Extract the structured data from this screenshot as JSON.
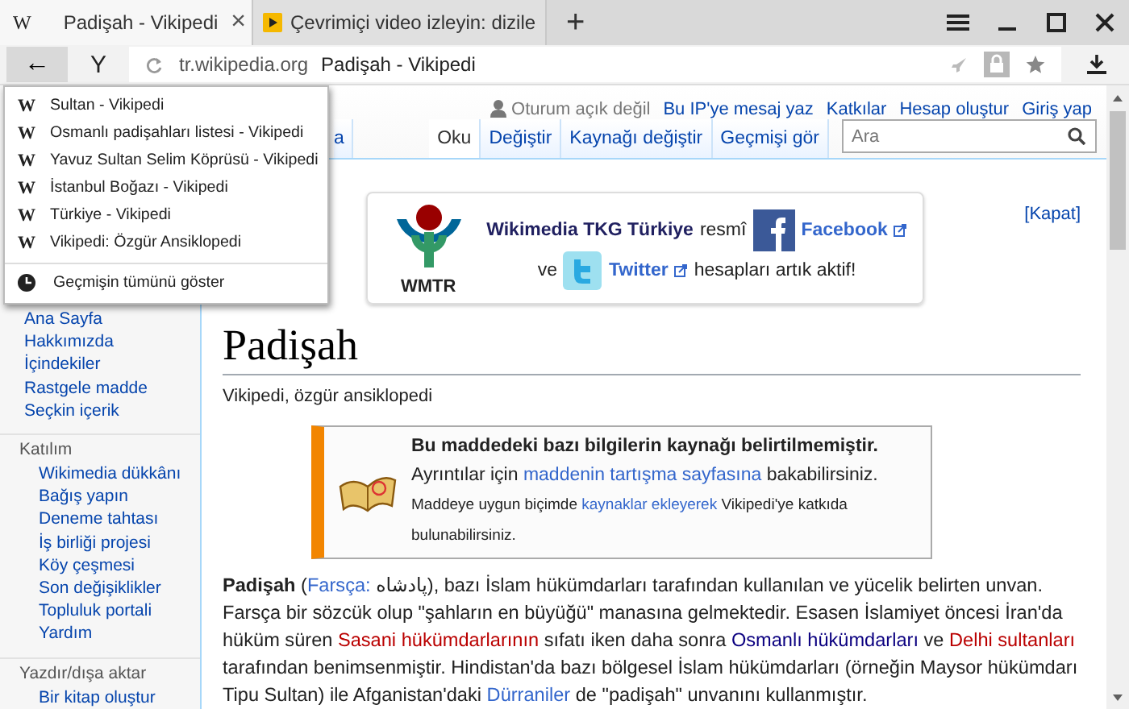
{
  "browser": {
    "tabs": [
      {
        "kind": "wiki",
        "favicon": "W",
        "title": "Padişah - Vikipedi",
        "close": "×",
        "selected": true
      },
      {
        "kind": "video",
        "title": "Çevrimiçi video izleyin: dizile",
        "selected": false
      }
    ],
    "new_tab": "+",
    "toolbar": {
      "back": "←",
      "logo": "Y",
      "domain": "tr.wikipedia.org",
      "page_title": "Padişah - Vikipedi"
    },
    "history_menu": {
      "items": [
        {
          "favicon": "W",
          "label": "Sultan - Vikipedi"
        },
        {
          "favicon": "W",
          "label": "Osmanlı padişahları listesi - Vikipedi"
        },
        {
          "favicon": "W",
          "label": "Yavuz Sultan Selim Köprüsü - Vikipedi"
        },
        {
          "favicon": "W",
          "label": "İstanbul Boğazı - Vikipedi"
        },
        {
          "favicon": "W",
          "label": "Türkiye - Vikipedi"
        },
        {
          "favicon": "W",
          "label": "Vikipedi: Özgür Ansiklopedi"
        }
      ],
      "show_all": "Geçmişin tümünü göster"
    }
  },
  "wiki": {
    "personal_links": [
      {
        "kind": "status",
        "label": "Oturum açık değil"
      },
      {
        "kind": "link",
        "label": "Bu IP'ye mesaj yaz"
      },
      {
        "kind": "link",
        "label": "Katkılar"
      },
      {
        "kind": "link",
        "label": "Hesap oluştur"
      },
      {
        "kind": "link",
        "label": "Giriş yap"
      }
    ],
    "namespace_tabs": [
      {
        "label": "a",
        "selected": false
      }
    ],
    "view_tabs": [
      {
        "label": "Oku",
        "selected": true
      },
      {
        "label": "Değiştir",
        "selected": false
      },
      {
        "label": "Kaynağı değiştir",
        "selected": false
      },
      {
        "label": "Geçmişi gör",
        "selected": false
      }
    ],
    "search": {
      "placeholder": "Ara"
    },
    "banner": {
      "logo_caption": "WMTR",
      "org": "Wikimedia TKG Türkiye",
      "word_official": "resmî",
      "facebook": "Facebook",
      "word_and": "ve",
      "twitter": "Twitter",
      "ending": "hesapları artık aktif!"
    },
    "dismiss": "[Kapat]",
    "title": "Padişah",
    "tagline": "Vikipedi, özgür ansiklopedi",
    "notice": [
      {
        "kind": "bold",
        "text": "Bu maddedeki bazı bilgilerin kaynağı belirtilmemiştir."
      },
      {
        "kind": "plain",
        "text": " Ayrıntılar için "
      },
      {
        "kind": "link",
        "text": "maddenin tartışma sayfasına"
      },
      {
        "kind": "plain",
        "text": " bakabilirsiniz. "
      },
      {
        "kind": "small",
        "text": "Maddeye uygun biçimde "
      },
      {
        "kind": "small_link",
        "text": "kaynaklar ekleyerek"
      },
      {
        "kind": "small",
        "text": " Vikipedi'ye katkıda bulunabilirsiniz."
      }
    ],
    "paragraph": [
      {
        "kind": "bold",
        "text": "Padişah"
      },
      {
        "kind": "plain",
        "text": " ("
      },
      {
        "kind": "link",
        "text": "Farsça:"
      },
      {
        "kind": "plain",
        "text": " پادشاه"
      },
      {
        "kind": "plain",
        "text": "), bazı İslam hükümdarları tarafından kullanılan ve yücelik belirten unvan. Farsça bir sözcük olup \"şahların en büyüğü\" manasına gelmektedir. Esasen İslamiyet öncesi İran'da hüküm süren "
      },
      {
        "kind": "redlink",
        "text": "Sasani hükümdarlarının"
      },
      {
        "kind": "plain",
        "text": " sıfatı iken daha sonra "
      },
      {
        "kind": "visited",
        "text": "Osmanlı hükümdarları"
      },
      {
        "kind": "plain",
        "text": " ve "
      },
      {
        "kind": "redlink",
        "text": "Delhi sultanları"
      },
      {
        "kind": "plain",
        "text": " tarafından benimsenmiştir. Hindistan'da bazı bölgesel İslam hükümdarları (örneğin Maysor hükümdarı Tipu Sultan) ile Afganistan'daki "
      },
      {
        "kind": "link",
        "text": "Dürraniler"
      },
      {
        "kind": "plain",
        "text": " de \"padişah\" unvanını kullanmıştır."
      }
    ],
    "sidebar": {
      "items": [
        "Ana Sayfa",
        "Hakkımızda",
        "İçindekiler",
        "Rastgele madde",
        "Seçkin içerik"
      ],
      "sections": [
        {
          "heading": "Katılım",
          "items": [
            "Wikimedia dükkânı",
            "Bağış yapın",
            "Deneme tahtası",
            "İş birliği projesi",
            "Köy çeşmesi",
            "Son değişiklikler",
            "Topluluk portali",
            "Yardım"
          ]
        },
        {
          "heading": "Yazdır/dışa aktar",
          "items": [
            "Bir kitap oluştur"
          ]
        }
      ]
    }
  }
}
